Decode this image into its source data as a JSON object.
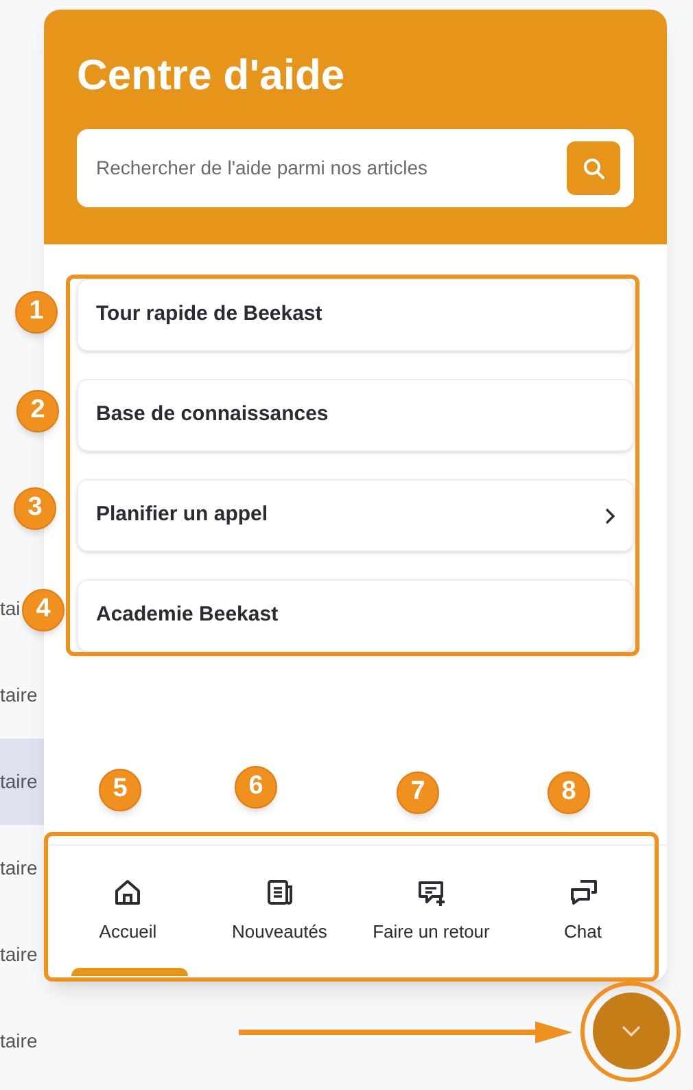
{
  "background_rows": [
    {
      "text": "tai",
      "highlighted": false
    },
    {
      "text": "taire",
      "highlighted": false
    },
    {
      "text": "taire",
      "highlighted": true
    },
    {
      "text": "taire",
      "highlighted": false
    },
    {
      "text": "taire",
      "highlighted": false
    },
    {
      "text": "taire",
      "highlighted": false
    }
  ],
  "help_panel": {
    "title": "Centre d'aide",
    "search": {
      "placeholder": "Rechercher de l'aide parmi nos articles"
    },
    "items": [
      {
        "label": "Tour rapide de Beekast",
        "chevron": false
      },
      {
        "label": "Base de connaissances",
        "chevron": false
      },
      {
        "label": "Planifier un appel",
        "chevron": true
      },
      {
        "label": "Academie Beekast",
        "chevron": false
      }
    ],
    "nav_tabs": [
      {
        "label": "Accueil",
        "kind": "home",
        "selected": true
      },
      {
        "label": "Nouveautés",
        "kind": "news",
        "selected": false
      },
      {
        "label": "Faire un retour",
        "kind": "feedback",
        "selected": false
      },
      {
        "label": "Chat",
        "kind": "chat",
        "selected": false
      }
    ]
  },
  "launcher": {
    "expanded": true
  },
  "annotation_markers": [
    {
      "label": "1"
    },
    {
      "label": "2"
    },
    {
      "label": "3"
    },
    {
      "label": "4"
    },
    {
      "label": "5"
    },
    {
      "label": "6"
    },
    {
      "label": "7"
    },
    {
      "label": "8"
    }
  ]
}
